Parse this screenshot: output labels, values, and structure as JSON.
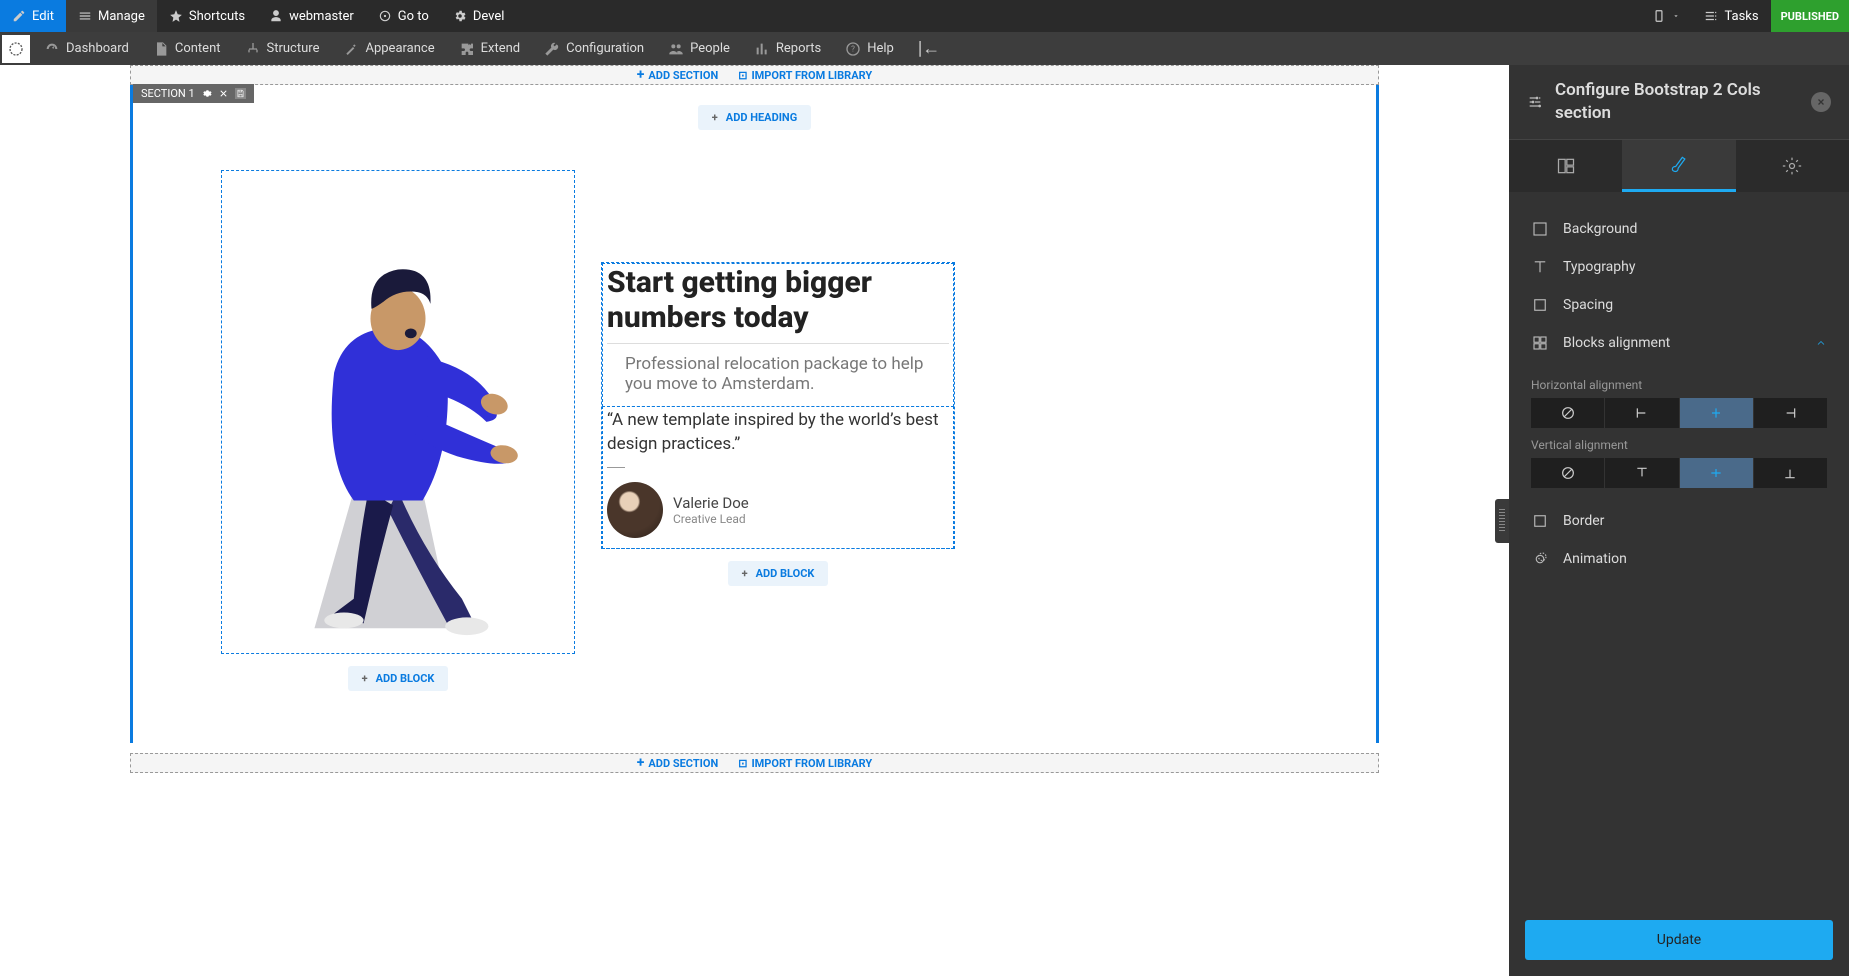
{
  "toolbar": {
    "edit": "Edit",
    "manage": "Manage",
    "shortcuts": "Shortcuts",
    "user": "webmaster",
    "goto": "Go to",
    "devel": "Devel",
    "tasks": "Tasks",
    "published": "PUBLISHED"
  },
  "subbar": {
    "dashboard": "Dashboard",
    "content": "Content",
    "structure": "Structure",
    "appearance": "Appearance",
    "extend": "Extend",
    "configuration": "Configuration",
    "people": "People",
    "reports": "Reports",
    "help": "Help"
  },
  "canvas": {
    "add_section": "ADD SECTION",
    "import_library": "IMPORT FROM LIBRARY",
    "section_label": "SECTION 1",
    "add_heading": "ADD HEADING",
    "add_block": "ADD BLOCK",
    "heading": "Start getting bigger numbers today",
    "subtext": "Professional relocation package to help you move to Amsterdam.",
    "quote": "“A new template inspired by the world’s best design practices.”",
    "person_name": "Valerie Doe",
    "person_role": "Creative Lead"
  },
  "sidebar": {
    "title": "Configure Bootstrap 2 Cols section",
    "rows": {
      "background": "Background",
      "typography": "Typography",
      "spacing": "Spacing",
      "blocks_alignment": "Blocks alignment",
      "border": "Border",
      "animation": "Animation"
    },
    "horiz_label": "Horizontal alignment",
    "vert_label": "Vertical alignment",
    "update": "Update"
  }
}
